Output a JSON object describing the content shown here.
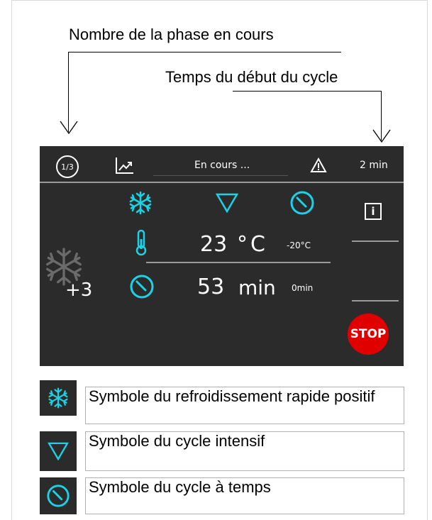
{
  "annotations": {
    "phase_number": "Nombre de la phase en cours",
    "cycle_time": "Temps du début du cycle"
  },
  "header": {
    "phase": "1/3",
    "status": "En cours ...",
    "elapsed": "2 min"
  },
  "icons": {
    "phase_icon": "phase-counter-icon",
    "graph_icon": "graph-icon",
    "warning_icon": "warning-icon",
    "snowflake_icon": "snowflake-icon",
    "intensive_icon": "triangle-down-icon",
    "timed_icon": "clock-icon",
    "thermometer_icon": "thermometer-icon",
    "info_icon": "info-icon"
  },
  "main": {
    "temperature": "23",
    "temperature_unit": "°C",
    "temperature_target": "-20°C",
    "time": "53",
    "time_unit": "min",
    "time_target": "0min",
    "cycle_type_label": "+3",
    "stop_label": "STOP"
  },
  "legend": [
    {
      "text": "Symbole du refroidissement rapide positif"
    },
    {
      "text": "Symbole du cycle intensif"
    },
    {
      "text": "Symbole du cycle à temps"
    }
  ],
  "colors": {
    "accent": "#19d3e6",
    "panel_bg": "#2b2b2b",
    "stop": "#e00000"
  }
}
